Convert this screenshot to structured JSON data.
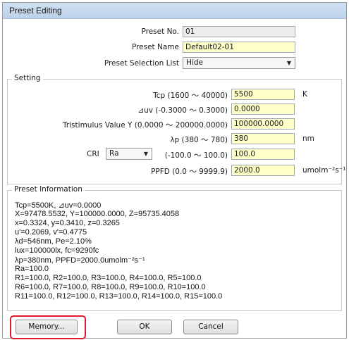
{
  "window": {
    "title": "Preset Editing"
  },
  "preset": {
    "no_label": "Preset No.",
    "no_value": "01",
    "name_label": "Preset Name",
    "name_value": "Default02-01",
    "selection_label": "Preset Selection List",
    "selection_value": "Hide"
  },
  "setting": {
    "title": "Setting",
    "tcp": {
      "label": "Tcp (1600 ～ 40000)",
      "value": "5500",
      "unit": "K"
    },
    "duv": {
      "label": "⊿uv (-0.3000 ～ 0.3000)",
      "value": "0.0000"
    },
    "tristimulus": {
      "label": "Tristimulus Value Y (0.0000 ～ 200000.0000)",
      "value": "100000.0000"
    },
    "lambda_p": {
      "label": "λp (380 ～ 780)",
      "value": "380",
      "unit": "nm"
    },
    "cri": {
      "label": "CRI",
      "select_value": "Ra",
      "range_label": "(-100.0 ～ 100.0)",
      "value": "100.0"
    },
    "ppfd": {
      "label": "PPFD (0.0 ～ 9999.9)",
      "value": "2000.0",
      "unit": "umolm⁻²s⁻¹"
    }
  },
  "info": {
    "title": "Preset Information",
    "lines": [
      "Tcp=5500K, ⊿uv=0.0000",
      "X=97478.5532, Y=100000.0000, Z=95735.4058",
      "x=0.3324, y=0.3410, z=0.3265",
      "u'=0.2069, v'=0.4775",
      "λd=546nm, Pe=2.10%",
      "lux=100000lx, fc=9290fc",
      "λp=380nm, PPFD=2000.0umolm⁻²s⁻¹",
      "Ra=100.0",
      "R1=100.0, R2=100.0, R3=100.0, R4=100.0, R5=100.0",
      "R6=100.0, R7=100.0, R8=100.0, R9=100.0, R10=100.0",
      "R11=100.0, R12=100.0, R13=100.0, R14=100.0, R15=100.0"
    ]
  },
  "buttons": {
    "memory": "Memory...",
    "ok": "OK",
    "cancel": "Cancel"
  },
  "colors": {
    "field_yellow": "#ffffc8",
    "highlight_red": "#e01b2e"
  }
}
